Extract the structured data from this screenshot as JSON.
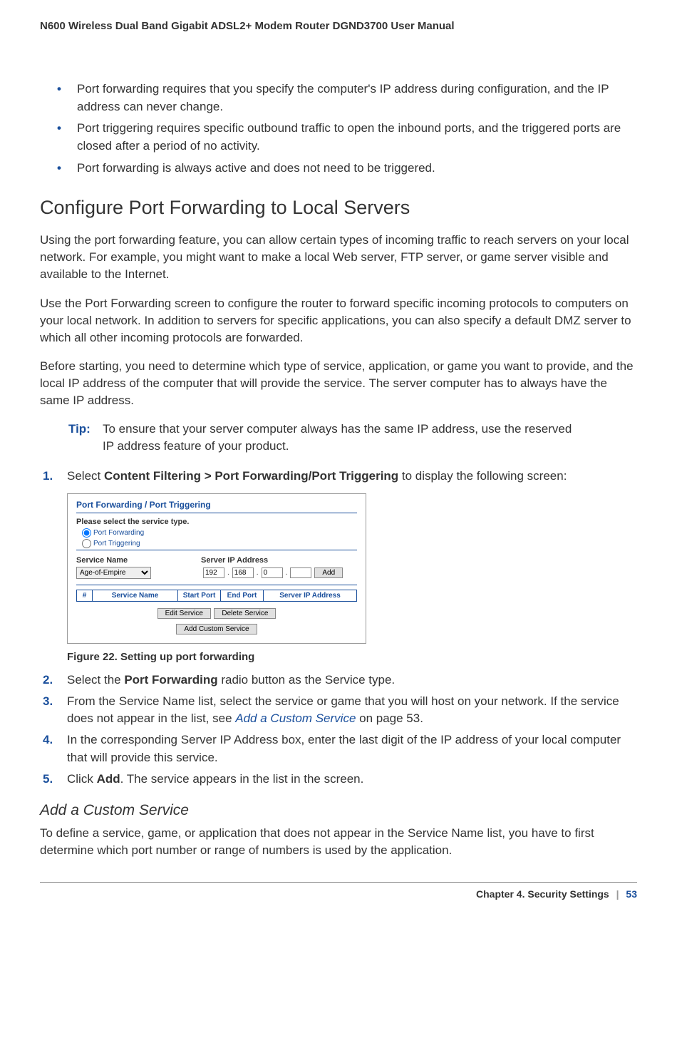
{
  "header": {
    "title": "N600 Wireless Dual Band Gigabit ADSL2+ Modem Router DGND3700 User Manual"
  },
  "intro_bullets": [
    "Port forwarding requires that you specify the computer's IP address during configuration, and the IP address can never change.",
    "Port triggering requires specific outbound traffic to open the inbound ports, and the triggered ports are closed after a period of no activity.",
    "Port forwarding is always active and does not need to be triggered."
  ],
  "section": {
    "heading": "Configure Port Forwarding to Local Servers",
    "p1": "Using the port forwarding feature, you can allow certain types of incoming traffic to reach servers on your local network. For example, you might want to make a local Web server, FTP server, or game server visible and available to the Internet.",
    "p2": "Use the Port Forwarding screen to configure the router to forward specific incoming protocols to computers on your local network. In addition to servers for specific applications, you can also specify a default DMZ server to which all other incoming protocols are forwarded.",
    "p3": "Before starting, you need to determine which type of service, application, or game you want to provide, and the local IP address of the computer that will provide the service. The server computer has to always have the same IP address."
  },
  "tip": {
    "label": "Tip:",
    "text": "To ensure that your server computer always has the same IP address, use the reserved IP address feature of your product."
  },
  "steps": {
    "s1_pre": "Select ",
    "s1_bold": "Content Filtering > Port Forwarding/Port Triggering",
    "s1_post": " to display the following screen:",
    "s2_pre": "Select the ",
    "s2_bold": "Port Forwarding",
    "s2_post": " radio button as the Service type.",
    "s3_pre": "From the Service Name list, select the service or game that you will host on your network. If the service does not appear in the list, see ",
    "s3_link": "Add a Custom Service",
    "s3_post": " on page 53.",
    "s4": "In the corresponding Server IP Address box, enter the last digit of the IP address of your local computer that will provide this service.",
    "s5_pre": "Click ",
    "s5_bold": "Add",
    "s5_post": ". The service appears in the list in the screen."
  },
  "step_numbers": {
    "n1": "1.",
    "n2": "2.",
    "n3": "3.",
    "n4": "4.",
    "n5": "5."
  },
  "figure": {
    "title": "Port Forwarding / Port Triggering",
    "select_label": "Please select the service type.",
    "radio_pf": "Port Forwarding",
    "radio_pt": "Port Triggering",
    "col_service_name": "Service Name",
    "col_server_ip": "Server IP Address",
    "select_value": "Age-of-Empire",
    "ip1": "192",
    "ip2": "168",
    "ip3": "0",
    "ip4": "",
    "btn_add": "Add",
    "th_num": "#",
    "th_sn": "Service Name",
    "th_sp": "Start Port",
    "th_ep": "End Port",
    "th_sip": "Server IP Address",
    "btn_edit": "Edit Service",
    "btn_delete": "Delete Service",
    "btn_custom": "Add Custom Service",
    "caption": "Figure 22.  Setting up port forwarding"
  },
  "subsection": {
    "heading": "Add a Custom Service",
    "p1": "To define a service, game, or application that does not appear in the Service Name list, you have to first determine which port number or range of numbers is used by the application."
  },
  "footer": {
    "chapter": "Chapter 4.  Security Settings",
    "sep": "|",
    "page": "53"
  }
}
